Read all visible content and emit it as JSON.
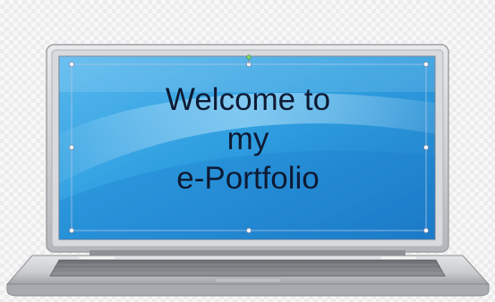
{
  "screen": {
    "lines": [
      "Welcome to",
      "my",
      "e-Portfolio"
    ]
  },
  "colors": {
    "screen_blue": "#2f9fe0",
    "screen_dark": "#1668b6",
    "bezel_gray": "#c5c7ca",
    "text": "#0e1a33"
  },
  "icons": {
    "selection_handles": "text-box-selection-handles"
  }
}
